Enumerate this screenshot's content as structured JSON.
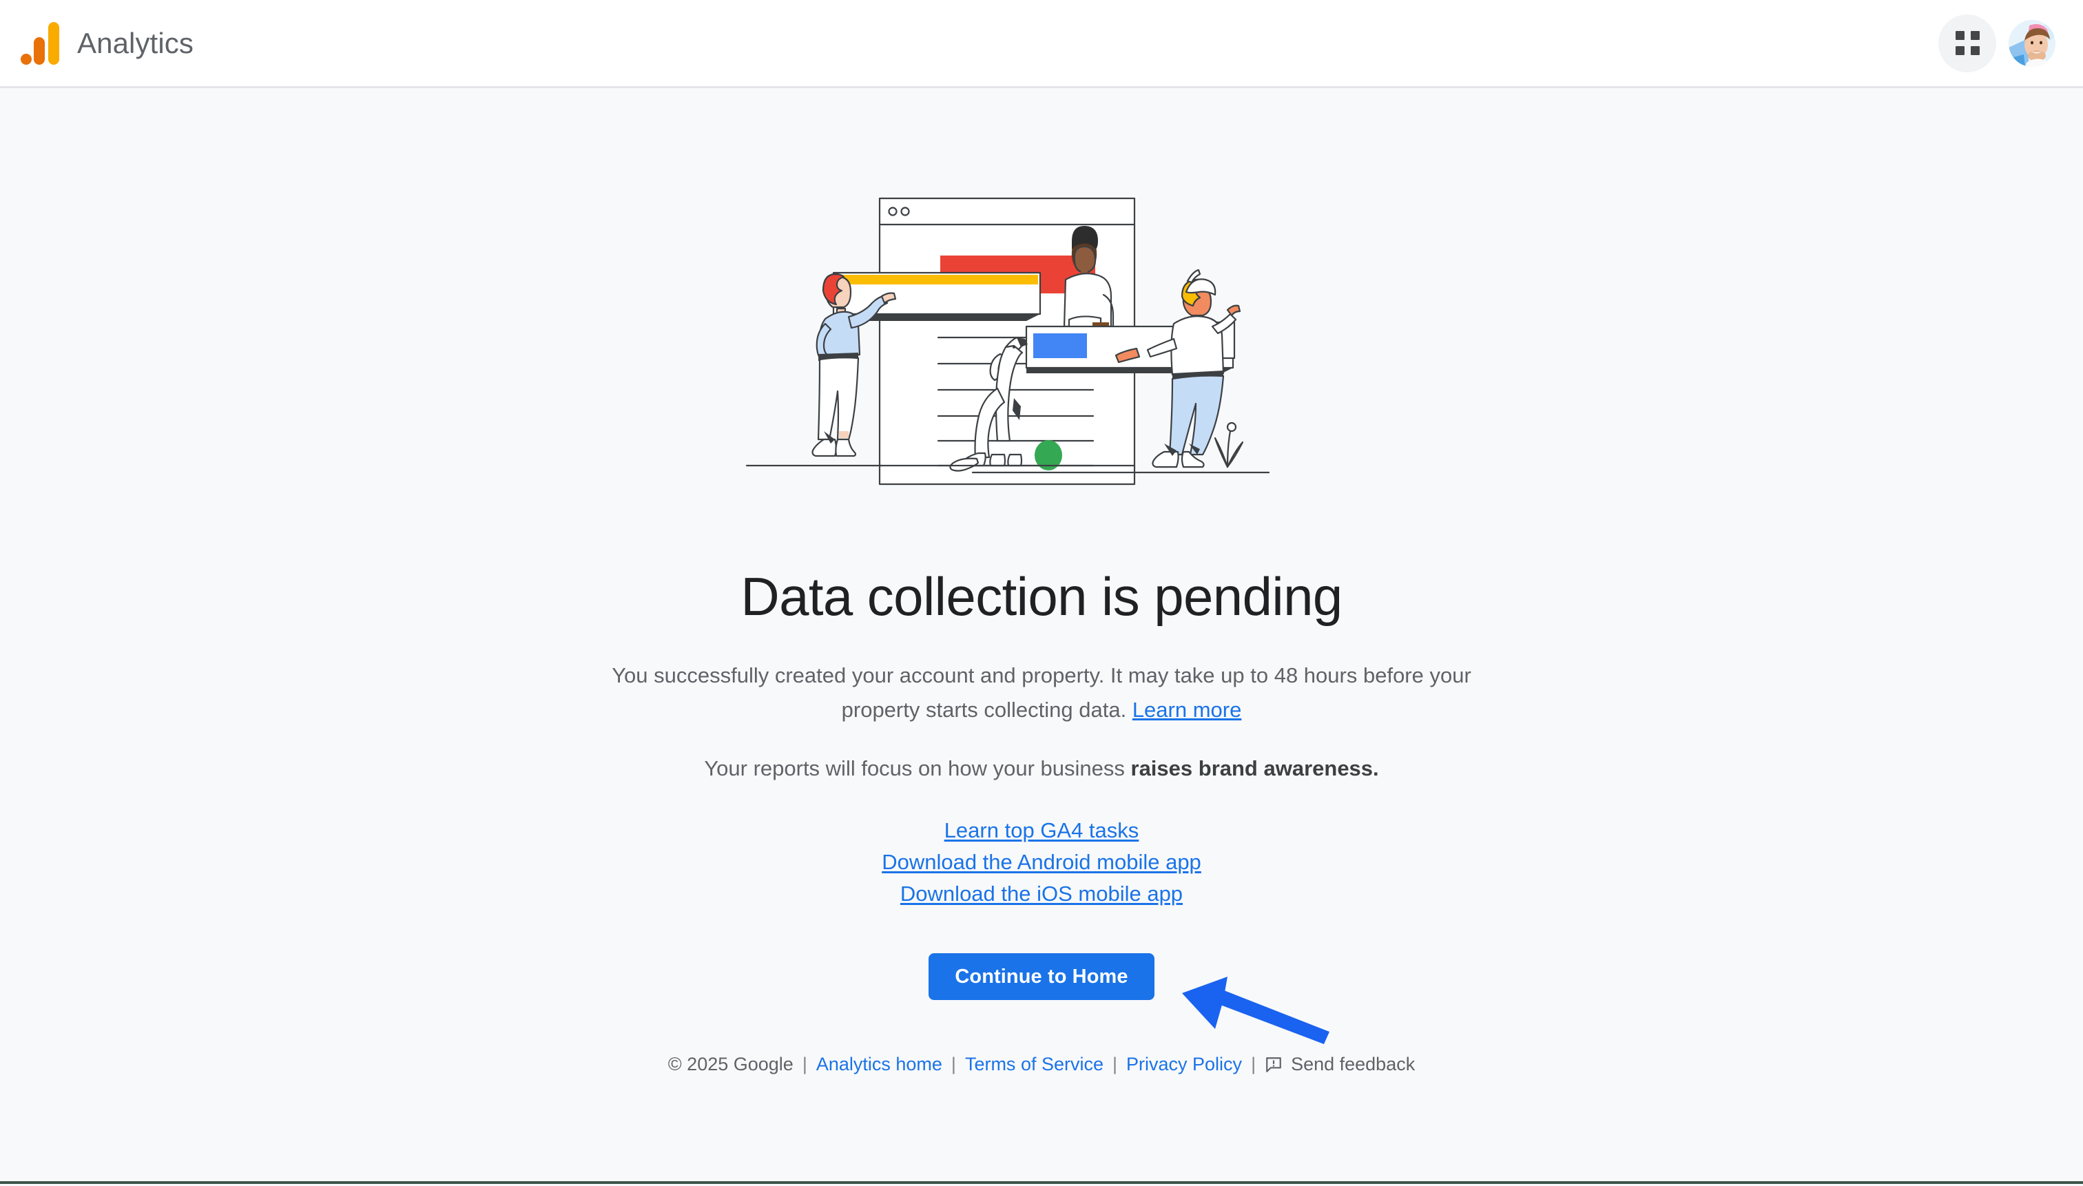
{
  "header": {
    "brand_label": "Analytics",
    "logo_icon": "google-analytics-logo",
    "apps_icon": "google-apps-grid-icon",
    "avatar_icon": "user-avatar",
    "colors": {
      "logo_dot": "#e8710a",
      "logo_mid": "#e8710a",
      "logo_tall": "#f9ab00"
    }
  },
  "main": {
    "illustration_name": "data-collection-pending-illustration",
    "title": "Data collection is pending",
    "description_text": "You successfully created your account and property. It may take up to 48 hours before your property starts collecting data.",
    "description_link": "Learn more",
    "focus_prefix": "Your reports will focus on how your business ",
    "focus_bold": "raises brand awareness.",
    "links": [
      {
        "label": "Learn top GA4 tasks",
        "name": "learn-top-ga4-tasks-link"
      },
      {
        "label": "Download the Android mobile app",
        "name": "download-android-app-link"
      },
      {
        "label": "Download the iOS mobile app",
        "name": "download-ios-app-link"
      }
    ],
    "cta_label": "Continue to Home",
    "cta_color": "#1a73e8",
    "annotation_arrow": "pointer-arrow",
    "annotation_arrow_color": "#1a62f0"
  },
  "footer": {
    "copyright": "© 2025 Google",
    "sep": "|",
    "analytics_home": "Analytics home",
    "terms": "Terms of Service",
    "privacy": "Privacy Policy",
    "feedback_label": "Send feedback",
    "feedback_icon": "feedback-bubble-icon"
  }
}
